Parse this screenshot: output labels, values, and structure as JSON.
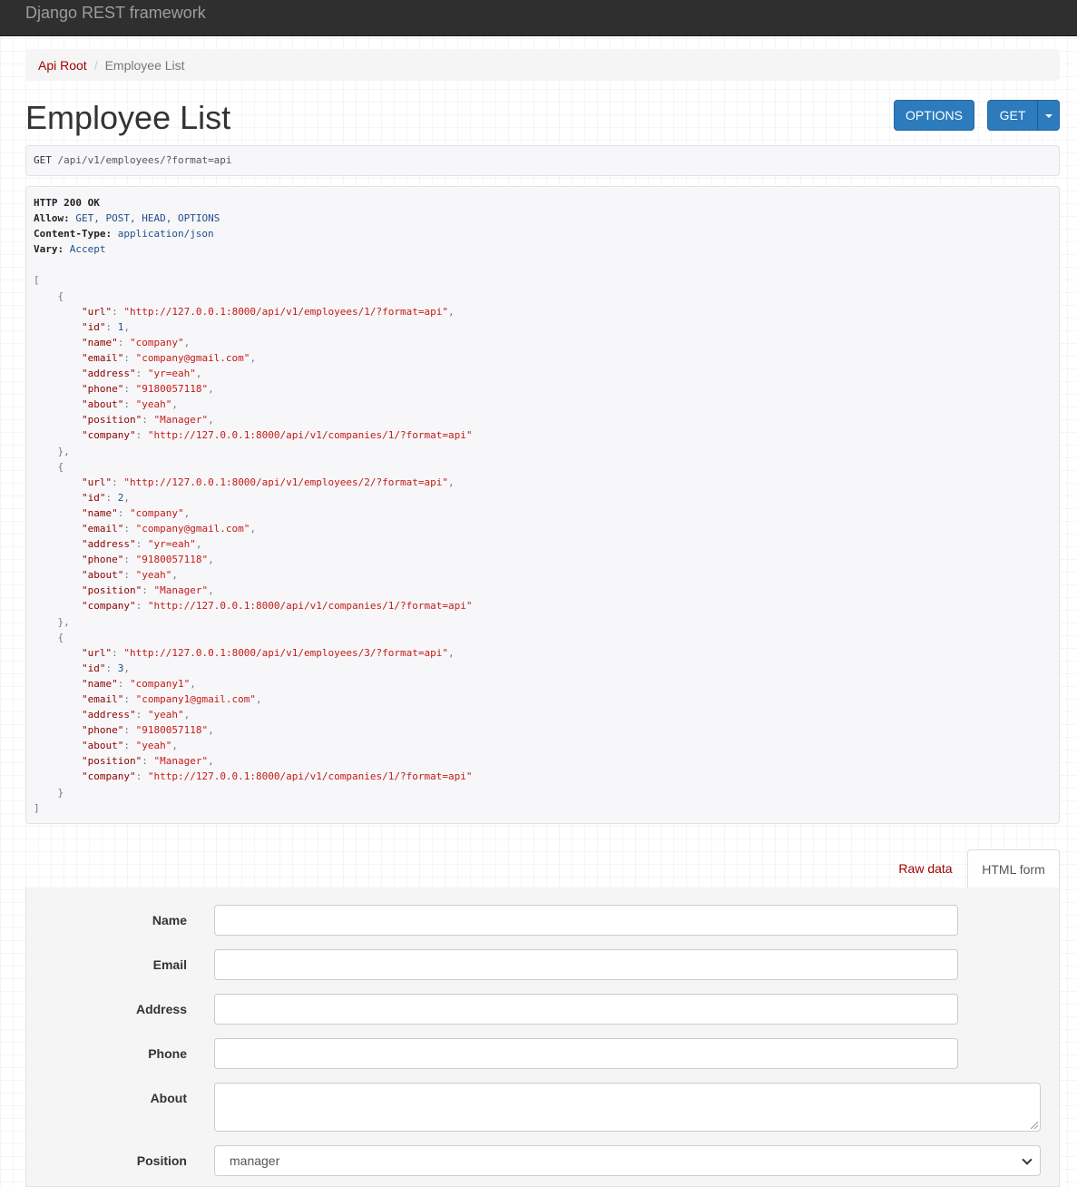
{
  "navbar": {
    "brand": "Django REST framework"
  },
  "breadcrumb": {
    "root": "Api Root",
    "separator": "/",
    "current": "Employee List"
  },
  "page": {
    "title": "Employee List"
  },
  "buttons": {
    "options": "OPTIONS",
    "get": "GET"
  },
  "request": {
    "method": "GET",
    "path": "/api/v1/employees/?format=api"
  },
  "response": {
    "status": "HTTP 200 OK",
    "headers": [
      {
        "key": "Allow",
        "value": "GET, POST, HEAD, OPTIONS"
      },
      {
        "key": "Content-Type",
        "value": "application/json"
      },
      {
        "key": "Vary",
        "value": "Accept"
      }
    ],
    "employees": [
      {
        "url": "http://127.0.0.1:8000/api/v1/employees/1/?format=api",
        "id": 1,
        "name": "company",
        "email": "company@gmail.com",
        "address": "yr=eah",
        "phone": "9180057118",
        "about": "yeah",
        "position": "Manager",
        "company": "http://127.0.0.1:8000/api/v1/companies/1/?format=api"
      },
      {
        "url": "http://127.0.0.1:8000/api/v1/employees/2/?format=api",
        "id": 2,
        "name": "company",
        "email": "company@gmail.com",
        "address": "yr=eah",
        "phone": "9180057118",
        "about": "yeah",
        "position": "Manager",
        "company": "http://127.0.0.1:8000/api/v1/companies/1/?format=api"
      },
      {
        "url": "http://127.0.0.1:8000/api/v1/employees/3/?format=api",
        "id": 3,
        "name": "company1",
        "email": "company1@gmail.com",
        "address": "yeah",
        "phone": "9180057118",
        "about": "yeah",
        "position": "Manager",
        "company": "http://127.0.0.1:8000/api/v1/companies/1/?format=api"
      }
    ]
  },
  "tabs": {
    "raw": "Raw data",
    "html": "HTML form"
  },
  "form": {
    "labels": {
      "name": "Name",
      "email": "Email",
      "address": "Address",
      "phone": "Phone",
      "about": "About",
      "position": "Position"
    },
    "position_selected": "manager"
  },
  "colors": {
    "navbar": "#2f2f2f",
    "button": "#2c7bbd",
    "link": "#a30000"
  }
}
